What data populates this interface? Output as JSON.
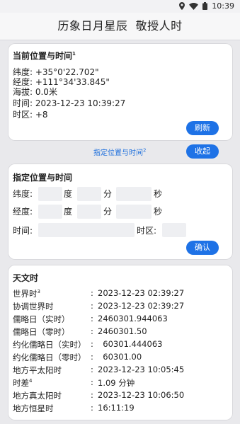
{
  "status": {
    "time": "10:39"
  },
  "app": {
    "title": "历象日月星辰  敬授人时"
  },
  "current": {
    "title": "当前位置与时间",
    "title_sup": "1",
    "lines": [
      "纬度: +35°0'22.702\"",
      "经度: +111°34'33.845\"",
      "海拔: 0.0米",
      "时间: 2023-12-23 10:39:27",
      "时区: +8"
    ],
    "refresh": "刷新"
  },
  "specify_link": {
    "label": "指定位置与时间",
    "sup": "2"
  },
  "collapse": "收起",
  "specify": {
    "title": "指定位置与时间",
    "lat_label": "纬度:",
    "lon_label": "经度:",
    "deg": "度",
    "min": "分",
    "sec": "秒",
    "time_label": "时间:",
    "zone_label": "时区:",
    "confirm": "确认"
  },
  "astro": {
    "title": "天文时",
    "rows": [
      {
        "k": "世界时",
        "sup": "3",
        "v": "2023-12-23 02:39:27"
      },
      {
        "k": "协调世界时",
        "sup": "",
        "v": "2023-12-23 02:39:27"
      },
      {
        "k": "儒略日（实时）",
        "sup": "",
        "v": "2460301.944063"
      },
      {
        "k": "儒略日（零时）",
        "sup": "",
        "v": "2460301.50"
      },
      {
        "k": "约化儒略日（实时）",
        "sup": "",
        "v": "  60301.444063"
      },
      {
        "k": "约化儒略日（零时）",
        "sup": "",
        "v": "  60301.00"
      },
      {
        "k": "地方平太阳时",
        "sup": "",
        "v": "2023-12-23 10:05:45"
      },
      {
        "k": "时差",
        "sup": "4",
        "v": "1.09 分钟"
      },
      {
        "k": "地方真太阳时",
        "sup": "",
        "v": "2023-12-23 10:06:50"
      },
      {
        "k": "地方恒星时",
        "sup": "",
        "v": "16:11:19"
      }
    ],
    "colon": ":"
  }
}
